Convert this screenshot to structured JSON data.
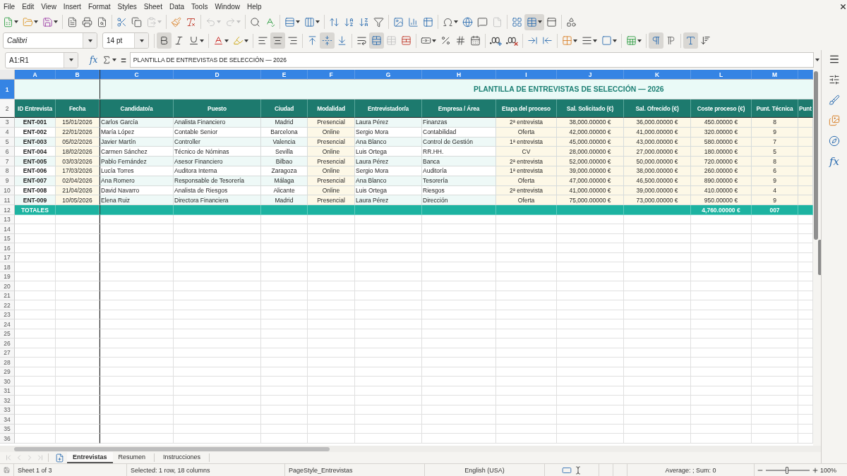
{
  "menu": [
    "File",
    "Edit",
    "View",
    "Insert",
    "Format",
    "Styles",
    "Sheet",
    "Data",
    "Tools",
    "Window",
    "Help"
  ],
  "standard_toolbar": [
    {
      "pressed": false,
      "disabled": false
    },
    {
      "pressed": false,
      "disabled": false
    },
    {
      "pressed": false,
      "disabled": false
    },
    {
      "pressed": false,
      "disabled": false
    },
    {
      "pressed": false,
      "disabled": false
    },
    {
      "pressed": false,
      "disabled": false
    },
    {
      "pressed": false,
      "disabled": false
    },
    {
      "pressed": false,
      "disabled": false
    },
    {
      "pressed": false,
      "disabled": true
    },
    {
      "pressed": false,
      "disabled": false
    },
    {
      "pressed": false,
      "disabled": false
    },
    {
      "pressed": false,
      "disabled": true
    },
    {
      "pressed": false,
      "disabled": true
    },
    {
      "pressed": false,
      "disabled": false
    },
    {
      "pressed": false,
      "disabled": false
    },
    {
      "pressed": false,
      "disabled": false
    },
    {
      "pressed": false,
      "disabled": false
    },
    {
      "pressed": false,
      "disabled": false
    },
    {
      "pressed": false,
      "disabled": false
    },
    {
      "pressed": false,
      "disabled": false
    },
    {
      "pressed": false,
      "disabled": false
    },
    {
      "pressed": false,
      "disabled": false
    },
    {
      "pressed": false,
      "disabled": false
    },
    {
      "pressed": false,
      "disabled": false
    },
    {
      "pressed": false,
      "disabled": false
    },
    {
      "pressed": false,
      "disabled": false
    },
    {
      "pressed": false,
      "disabled": false
    },
    {
      "pressed": false,
      "disabled": true
    },
    {
      "pressed": false,
      "disabled": false
    },
    {
      "pressed": true,
      "disabled": false
    },
    {
      "pressed": false,
      "disabled": false
    },
    {
      "pressed": false,
      "disabled": false
    }
  ],
  "formatting_toolbar": {
    "font_name": "Calibri",
    "font_size": "14 pt",
    "buttons": [
      {
        "pressed": true,
        "disabled": false
      },
      {
        "pressed": false,
        "disabled": false
      },
      {
        "pressed": false,
        "disabled": false
      },
      {
        "pressed": false,
        "disabled": false
      },
      {
        "pressed": false,
        "disabled": false
      },
      {
        "pressed": false,
        "disabled": false
      },
      {
        "pressed": true,
        "disabled": false
      },
      {
        "pressed": false,
        "disabled": false
      },
      {
        "pressed": false,
        "disabled": false
      },
      {
        "pressed": true,
        "disabled": false
      },
      {
        "pressed": false,
        "disabled": false
      },
      {
        "pressed": false,
        "disabled": false
      },
      {
        "pressed": true,
        "disabled": false
      },
      {
        "pressed": false,
        "disabled": true
      },
      {
        "pressed": false,
        "disabled": false
      },
      {
        "pressed": false,
        "disabled": false
      },
      {
        "pressed": false,
        "disabled": false
      },
      {
        "pressed": false,
        "disabled": false
      },
      {
        "pressed": false,
        "disabled": false
      },
      {
        "pressed": false,
        "disabled": false
      },
      {
        "pressed": false,
        "disabled": false
      },
      {
        "pressed": false,
        "disabled": false
      },
      {
        "pressed": false,
        "disabled": false
      },
      {
        "pressed": false,
        "disabled": false
      },
      {
        "pressed": false,
        "disabled": false
      },
      {
        "pressed": false,
        "disabled": false
      },
      {
        "pressed": false,
        "disabled": false
      },
      {
        "pressed": true,
        "disabled": false
      },
      {
        "pressed": false,
        "disabled": false
      },
      {
        "pressed": true,
        "disabled": false
      },
      {
        "pressed": false,
        "disabled": false
      }
    ]
  },
  "formula_bar": {
    "name_box": "A1:R1",
    "function_wizard": "fx",
    "formula_sign": "=",
    "content": "PLANTILLA DE ENTREVISTAS DE SELECCIÓN — 2026"
  },
  "sheet": {
    "column_letters": [
      {
        "label": "A",
        "selected": true
      },
      {
        "label": "B",
        "selected": true
      },
      {
        "label": "C",
        "selected": true
      },
      {
        "label": "D",
        "selected": true
      },
      {
        "label": "E",
        "selected": true
      },
      {
        "label": "F",
        "selected": true
      },
      {
        "label": "G",
        "selected": true
      },
      {
        "label": "H",
        "selected": true
      },
      {
        "label": "I",
        "selected": true
      },
      {
        "label": "J",
        "selected": true
      },
      {
        "label": "K",
        "selected": true
      },
      {
        "label": "L",
        "selected": true
      },
      {
        "label": "M",
        "selected": true
      },
      {
        "selected": true
      }
    ],
    "row_numbers": [
      {
        "label": "1",
        "selected": true
      },
      {
        "label": "2",
        "selected": false
      },
      {
        "label": "3",
        "selected": false
      },
      {
        "label": "4",
        "selected": false
      },
      {
        "label": "5",
        "selected": false
      },
      {
        "label": "6",
        "selected": false
      },
      {
        "label": "7",
        "selected": false
      },
      {
        "label": "8",
        "selected": false
      },
      {
        "label": "9",
        "selected": false
      },
      {
        "label": "10",
        "selected": false
      },
      {
        "label": "11",
        "selected": false
      },
      {
        "label": "12",
        "selected": false
      },
      {
        "label": "13",
        "selected": false
      },
      {
        "label": "14",
        "selected": false
      },
      {
        "label": "15",
        "selected": false
      },
      {
        "label": "16",
        "selected": false
      },
      {
        "label": "17",
        "selected": false
      },
      {
        "label": "18",
        "selected": false
      },
      {
        "label": "19",
        "selected": false
      },
      {
        "label": "20",
        "selected": false
      },
      {
        "label": "21",
        "selected": false
      },
      {
        "label": "22",
        "selected": false
      },
      {
        "label": "23",
        "selected": false
      },
      {
        "label": "24",
        "selected": false
      },
      {
        "label": "25",
        "selected": false
      },
      {
        "label": "26",
        "selected": false
      },
      {
        "label": "27",
        "selected": false
      },
      {
        "label": "28",
        "selected": false
      },
      {
        "label": "29",
        "selected": false
      },
      {
        "label": "30",
        "selected": false
      },
      {
        "label": "31",
        "selected": false
      },
      {
        "label": "32",
        "selected": false
      },
      {
        "label": "33",
        "selected": false
      },
      {
        "label": "34",
        "selected": false
      },
      {
        "label": "35",
        "selected": false
      },
      {
        "label": "36",
        "selected": false
      }
    ],
    "title": "PLANTILLA DE ENTREVISTAS DE SELECCIÓN — 2026",
    "columns": [
      {
        "header": "ID Entrevista",
        "shaded": false
      },
      {
        "header": "Fecha",
        "shaded": true
      },
      {
        "header": "Candidato/a",
        "shaded": false
      },
      {
        "header": "Puesto",
        "shaded": false
      },
      {
        "header": "Ciudad",
        "shaded": false
      },
      {
        "header": "Modalidad",
        "shaded": true
      },
      {
        "header": "Entrevistador/a",
        "shaded": false
      },
      {
        "header": "Empresa / Área",
        "shaded": false
      },
      {
        "header": "Etapa del proceso",
        "shaded": true
      },
      {
        "header": "Sal. Solicitado (€)",
        "shaded": true
      },
      {
        "header": "Sal. Ofrecido (€)",
        "shaded": true
      },
      {
        "header": "Coste proceso (€)",
        "shaded": true
      },
      {
        "header": "Punt. Técnica",
        "shaded": true
      },
      {
        "header": "Punt",
        "shaded": true
      }
    ],
    "rows": [
      [
        "ENT-001",
        "15/01/2026",
        "Carlos García",
        "Analista Financiero",
        "Madrid",
        "Presencial",
        "Laura Pérez",
        "Finanzas",
        "2ª entrevista",
        "38,000.00000 €",
        "36,000.00000 €",
        "450.00000 €",
        "8"
      ],
      [
        "ENT-002",
        "22/01/2026",
        "María López",
        "Contable Senior",
        "Barcelona",
        "Online",
        "Sergio Mora",
        "Contabilidad",
        "Oferta",
        "42,000.00000 €",
        "41,000.00000 €",
        "320.00000 €",
        "9"
      ],
      [
        "ENT-003",
        "05/02/2026",
        "Javier Martín",
        "Controller",
        "Valencia",
        "Presencial",
        "Ana Blanco",
        "Control de Gestión",
        "1ª entrevista",
        "45,000.00000 €",
        "43,000.00000 €",
        "580.00000 €",
        "7"
      ],
      [
        "ENT-004",
        "18/02/2026",
        "Carmen Sánchez",
        "Técnico de Nóminas",
        "Sevilla",
        "Online",
        "Luis Ortega",
        "RR.HH.",
        "CV",
        "28,000.00000 €",
        "27,000.00000 €",
        "180.00000 €",
        "5"
      ],
      [
        "ENT-005",
        "03/03/2026",
        "Pablo Fernández",
        "Asesor Financiero",
        "Bilbao",
        "Presencial",
        "Laura Pérez",
        "Banca",
        "2ª entrevista",
        "52,000.00000 €",
        "50,000.00000 €",
        "720.00000 €",
        "8"
      ],
      [
        "ENT-006",
        "17/03/2026",
        "Lucía Torres",
        "Auditora Interna",
        "Zaragoza",
        "Online",
        "Sergio Mora",
        "Auditoría",
        "1ª entrevista",
        "39,000.00000 €",
        "38,000.00000 €",
        "260.00000 €",
        "6"
      ],
      [
        "ENT-007",
        "02/04/2026",
        "Ana Romero",
        "Responsable de Tesorería",
        "Málaga",
        "Presencial",
        "Ana Blanco",
        "Tesorería",
        "Oferta",
        "47,000.00000 €",
        "46,500.00000 €",
        "890.00000 €",
        "9"
      ],
      [
        "ENT-008",
        "21/04/2026",
        "David Navarro",
        "Analista de Riesgos",
        "Alicante",
        "Online",
        "Luis Ortega",
        "Riesgos",
        "2ª entrevista",
        "41,000.00000 €",
        "39,000.00000 €",
        "410.00000 €",
        "4"
      ],
      [
        "ENT-009",
        "10/05/2026",
        "Elena Ruiz",
        "Directora Financiera",
        "Madrid",
        "Presencial",
        "Laura Pérez",
        "Dirección",
        "Oferta",
        "75,000.00000 €",
        "73,000.00000 €",
        "950.00000 €",
        "9"
      ]
    ],
    "totals": {
      "label": "TOTALES",
      "coste": "4,760.00000 €",
      "punt_tecnica": "007"
    }
  },
  "sheet_navigation": [
    {
      "disabled": true
    },
    {
      "disabled": true
    },
    {
      "disabled": true
    },
    {
      "disabled": true
    }
  ],
  "sheet_tabs": [
    {
      "label": "Entrevistas",
      "selected": true
    },
    {
      "label": "Resumen",
      "selected": false
    },
    {
      "label": "Instrucciones",
      "selected": false
    }
  ],
  "sidebar": {
    "functions": "fx"
  },
  "status_bar": {
    "sheet": "Sheet 1 of 3",
    "selection": "Selected: 1 row, 18 columns",
    "page_style": "PageStyle_Entrevistas",
    "language": "English (USA)",
    "summary": "Average: ; Sum: 0",
    "zoom": "100%",
    "zoom_slider": {
      "level": 0.48
    }
  }
}
